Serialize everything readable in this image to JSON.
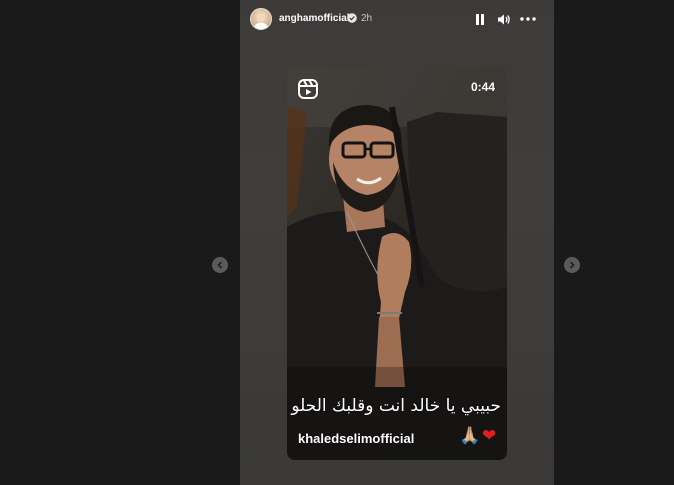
{
  "story": {
    "username": "anghamofficial",
    "time_ago": "2h",
    "video": {
      "duration": "0:44",
      "caption": "حبيبي يا خالد انت وقلبك الحلو ده",
      "mention": "khaledselimofficial",
      "emoji_heart": "❤",
      "emoji_pray": "🙏🏼"
    }
  },
  "icons": {
    "avatar": "avatar",
    "verified": "verified-badge-icon",
    "pause": "pause-icon",
    "mute": "volume-icon",
    "more": "more-options-icon",
    "reels": "reels-icon",
    "prev": "chevron-left-icon",
    "next": "chevron-right-icon"
  },
  "colors": {
    "background": "#1a1a1a",
    "story_background": "#3d3b39",
    "nav_button": "#5a5a5a",
    "heart": "#e02020"
  }
}
